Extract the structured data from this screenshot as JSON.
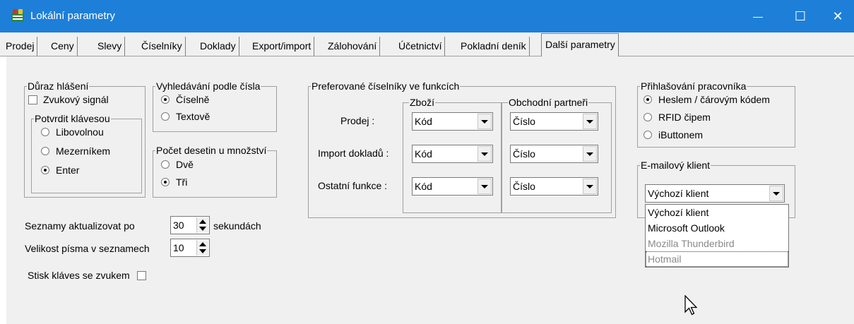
{
  "window": {
    "title": "Lokální parametry",
    "minimize_glyph": "—",
    "maximize_glyph": "☐",
    "close_glyph": "✕"
  },
  "tabs": [
    "Prodej",
    "Ceny",
    "Slevy",
    "Číselníky",
    "Doklady",
    "Export/import",
    "Zálohování",
    "Účetnictví",
    "Pokladní deník",
    "Další parametry"
  ],
  "duraz": {
    "title": "Důraz hlášení",
    "zvukovy": {
      "label": "Zvukový signál",
      "checked": false
    },
    "potvrdit": {
      "title": "Potvrdit klávesou",
      "options": [
        "Libovolnou",
        "Mezerníkem",
        "Enter"
      ],
      "selected": "Enter"
    }
  },
  "vyhledavani": {
    "title": "Vyhledávání podle čísla",
    "options": [
      "Číselně",
      "Textově"
    ],
    "selected": "Číselně"
  },
  "desetiny": {
    "title": "Počet desetin u množství",
    "options": [
      "Dvě",
      "Tři"
    ],
    "selected": "Tři"
  },
  "preferovane": {
    "title": "Preferované číselníky ve funkcích",
    "zbozi_title": "Zboží",
    "partneri_title": "Obchodní partneři",
    "rows": [
      {
        "label": "Prodej :",
        "zbozi": "Kód",
        "partner": "Číslo"
      },
      {
        "label": "Import dokladů :",
        "zbozi": "Kód",
        "partner": "Číslo"
      },
      {
        "label": "Ostatní funkce :",
        "zbozi": "Kód",
        "partner": "Číslo"
      }
    ]
  },
  "prihlasovani": {
    "title": "Přihlašování pracovníka",
    "options": [
      "Heslem / čárovým kódem",
      "RFID čipem",
      "iButtonem"
    ],
    "selected": "Heslem / čárovým kódem"
  },
  "email": {
    "title": "E-mailový klient",
    "value": "Výchozí klient",
    "options": [
      "Výchozí klient",
      "Microsoft Outlook",
      "Mozilla Thunderbird",
      "Hotmail"
    ]
  },
  "seznamy": {
    "label": "Seznamy aktualizovat po",
    "value": "30",
    "suffix": "sekundách"
  },
  "velikost": {
    "label": "Velikost písma v seznamech",
    "value": "10"
  },
  "stisk": {
    "label": "Stisk kláves se zvukem",
    "checked": false
  },
  "colors": {
    "titlebar": "#1e7fd8",
    "panel": "#f0f0f0"
  }
}
